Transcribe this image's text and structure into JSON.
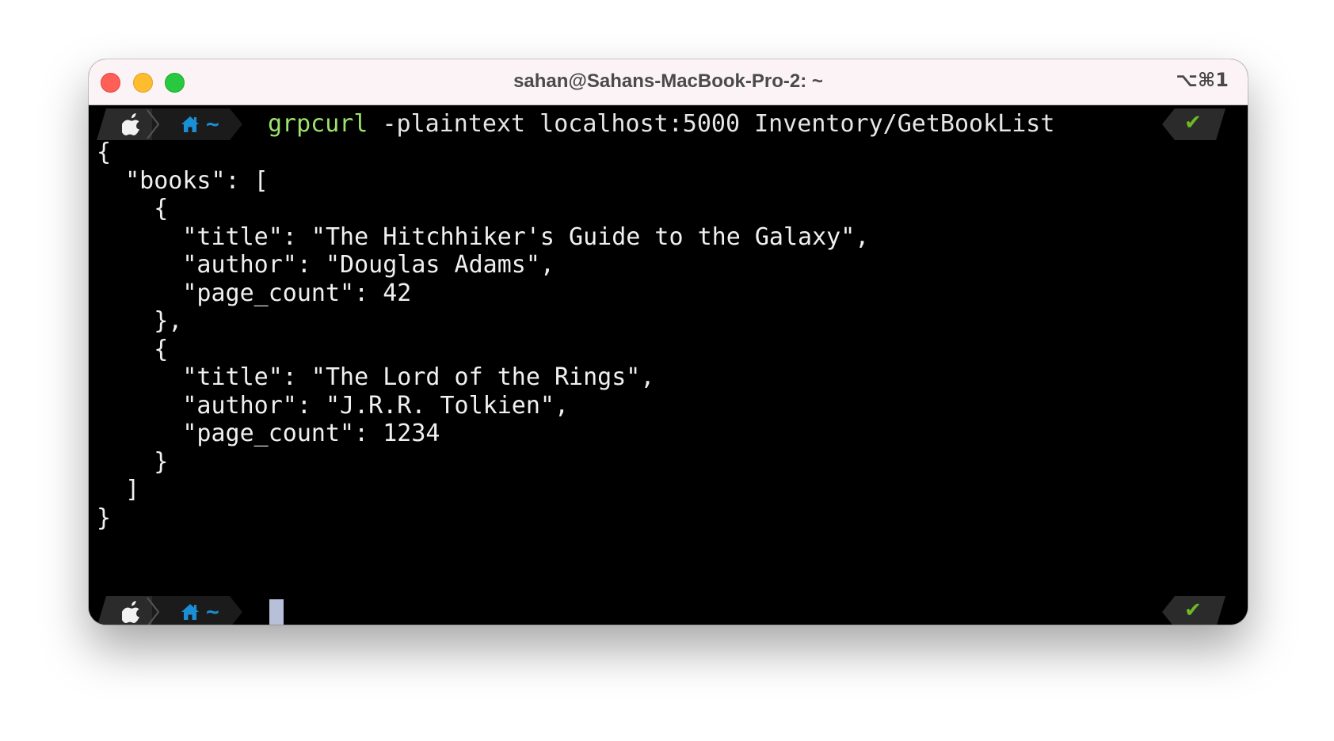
{
  "window": {
    "title": "sahan@Sahans-MacBook-Pro-2: ~",
    "shortcut": "⌥⌘1"
  },
  "prompt": {
    "os_icon": "apple-icon",
    "dir_icon": "home-icon",
    "dir_text": "~",
    "status_icon": "check-icon",
    "status_text": "✔"
  },
  "command": {
    "binary": "grpcurl",
    "args": " -plaintext localhost:5000 Inventory/GetBookList"
  },
  "output": {
    "lines": [
      "{",
      "  \"books\": [",
      "    {",
      "      \"title\": \"The Hitchhiker's Guide to the Galaxy\",",
      "      \"author\": \"Douglas Adams\",",
      "      \"page_count\": 42",
      "    },",
      "    {",
      "      \"title\": \"The Lord of the Rings\",",
      "      \"author\": \"J.R.R. Tolkien\",",
      "      \"page_count\": 1234",
      "    }",
      "  ]",
      "}"
    ]
  },
  "colors": {
    "titlebar": "#fbf3f6",
    "terminal_bg": "#000000",
    "command_binary": "#9ee36a",
    "dir_blue": "#1a8fd6",
    "status_green": "#6dbb24",
    "cursor": "#b7bfd9"
  }
}
